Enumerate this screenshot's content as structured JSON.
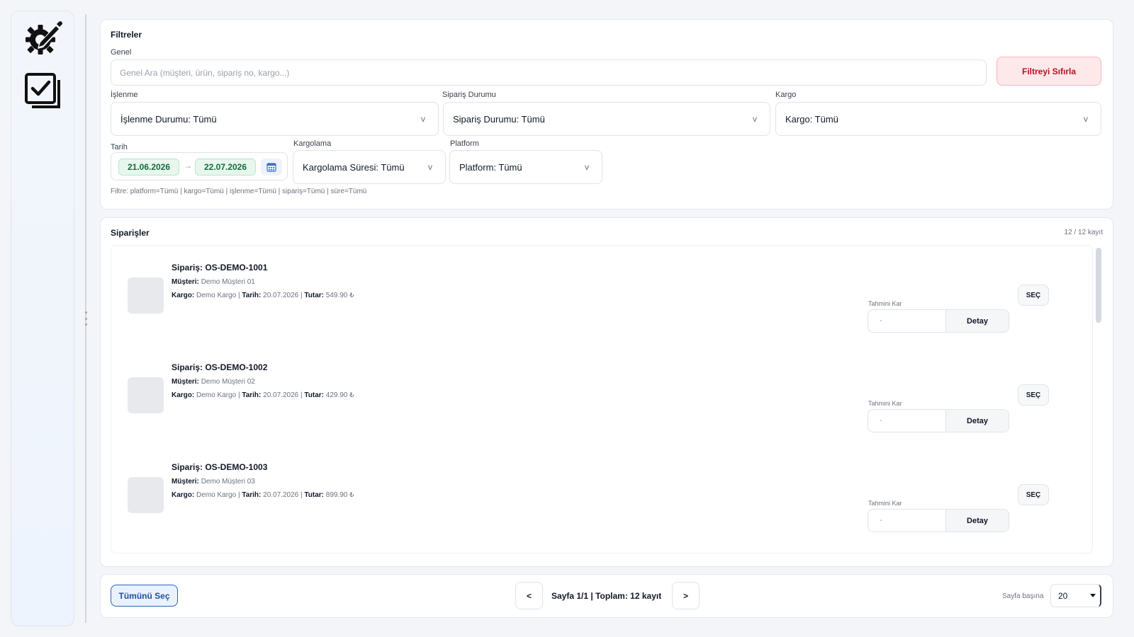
{
  "sidebar": {
    "icons": [
      "edit-gear-icon",
      "checklist-icon"
    ]
  },
  "filters": {
    "title": "Filtreler",
    "general": {
      "label": "Genel",
      "placeholder": "Genel Ara (müşteri, ürün, sipariş no, kargo...)",
      "value": ""
    },
    "reset_label": "Filtreyi Sıfırla",
    "processing": {
      "label": "İşlenme",
      "value": "İşlenme Durumu: Tümü"
    },
    "order_status": {
      "label": "Sipariş Durumu",
      "value": "Sipariş Durumu: Tümü"
    },
    "cargo": {
      "label": "Kargo",
      "value": "Kargo: Tümü"
    },
    "date": {
      "label": "Tarih",
      "start": "21.06.2026",
      "arrow": "→",
      "end": "22.07.2026"
    },
    "shipping": {
      "label": "Kargolama",
      "value": "Kargolama Süresi: Tümü"
    },
    "platform": {
      "label": "Platform",
      "value": "Platform: Tümü"
    },
    "chevron": "v",
    "summary": "Filtre: platform=Tümü | kargo=Tümü | işlenme=Tümü | sipariş=Tümü | süre=Tümü"
  },
  "orders": {
    "title": "Siparişler",
    "count": "12 / 12 kayıt",
    "labels": {
      "customer": "Müşteri:",
      "cargo": "Kargo:",
      "date": "Tarih:",
      "amount": "Tutar:",
      "sep": "|",
      "profit": "Tahmini Kar",
      "detail": "Detay",
      "select": "SEÇ"
    },
    "items": [
      {
        "title": "Sipariş: OS-DEMO-1001",
        "customer": "Demo Müşteri 01",
        "cargo": "Demo Kargo",
        "date": "20.07.2026",
        "amount": "549.90 ₺",
        "profit": "-"
      },
      {
        "title": "Sipariş: OS-DEMO-1002",
        "customer": "Demo Müşteri 02",
        "cargo": "Demo Kargo",
        "date": "20.07.2026",
        "amount": "429.90 ₺",
        "profit": "-"
      },
      {
        "title": "Sipariş: OS-DEMO-1003",
        "customer": "Demo Müşteri 03",
        "cargo": "Demo Kargo",
        "date": "20.07.2026",
        "amount": "899.90 ₺",
        "profit": "-"
      }
    ]
  },
  "footer": {
    "select_all": "Tümünü Seç",
    "prev": "<",
    "next": ">",
    "page_info": "Sayfa 1/1 | Toplam: 12 kayıt",
    "per_page_label": "Sayfa başına",
    "per_page_value": "20"
  }
}
